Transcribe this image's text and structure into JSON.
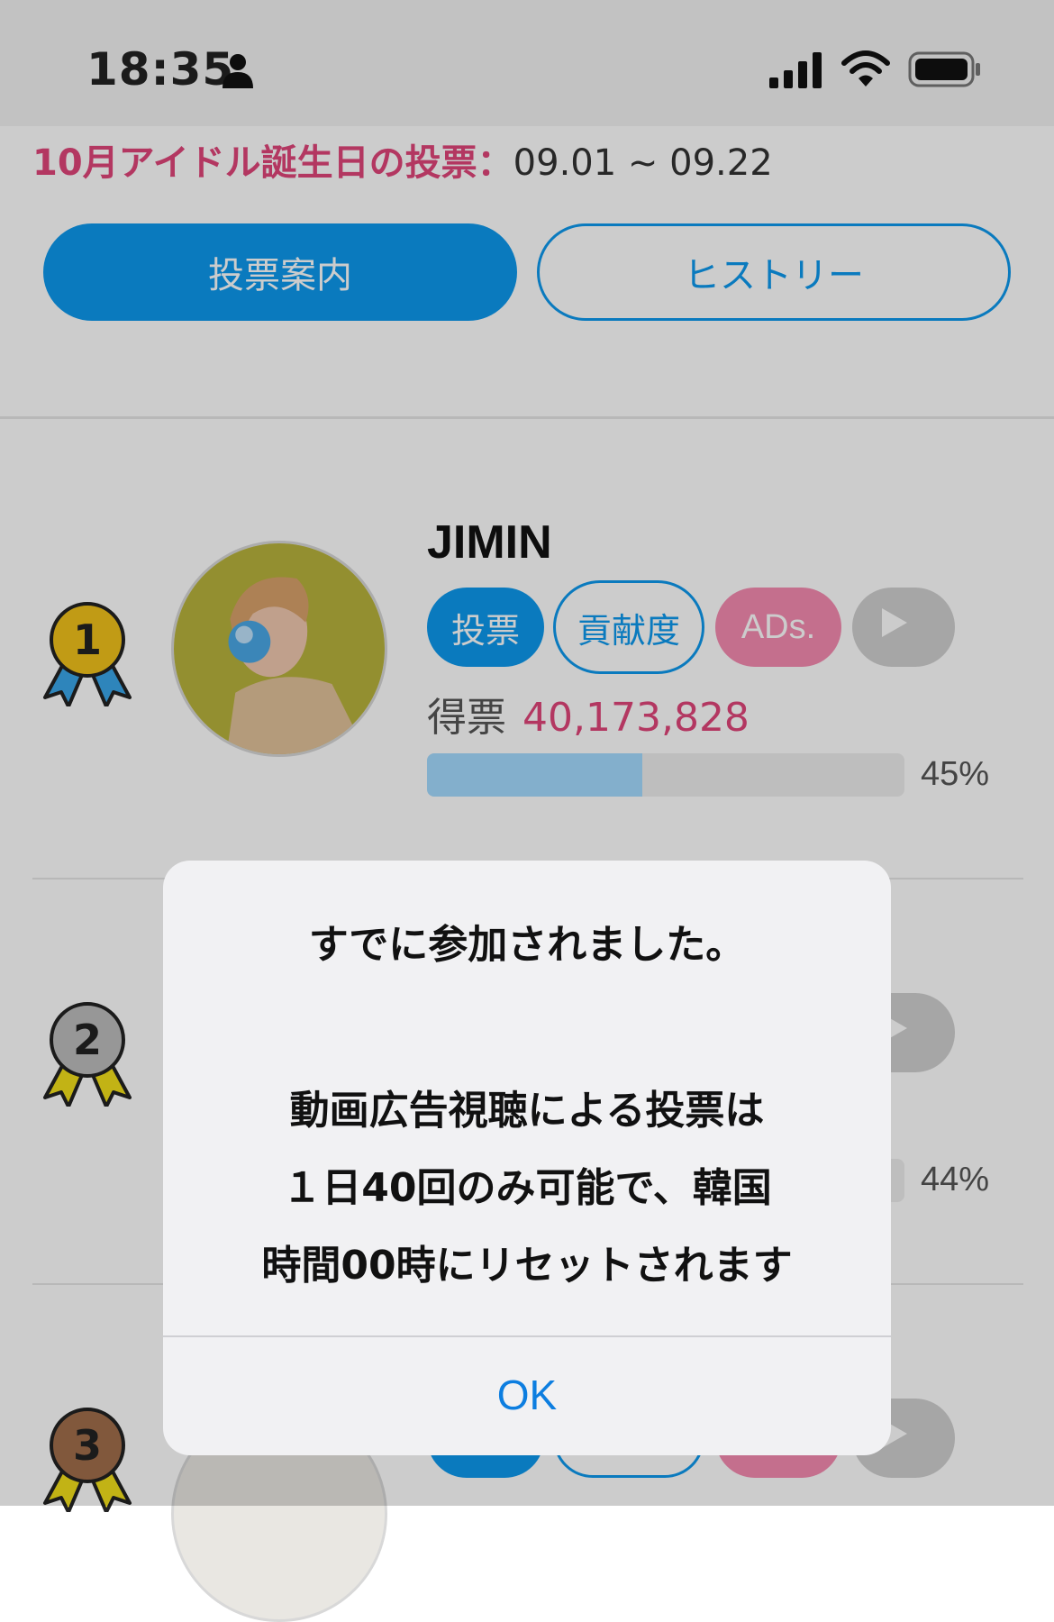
{
  "status_bar": {
    "time": "18:35"
  },
  "header": {
    "period_label": "10月アイドル誕生日の投票：",
    "period_range": "09.01 ~ 09.22"
  },
  "tabs": {
    "guide": "投票案内",
    "history": "ヒストリー"
  },
  "ranking": [
    {
      "rank": "1",
      "name": "JIMIN",
      "vote_label": "投票",
      "contribution_label": "貢献度",
      "ads_label": "ADs.",
      "votes_label": "得票",
      "votes": "40,173,828",
      "percent_text": "45%",
      "percent_value": 45,
      "medal_color": "#f2c21b",
      "ribbon_color": "#3aa7ea"
    },
    {
      "rank": "2",
      "percent_text": "44%",
      "percent_value": 44,
      "medal_color": "#bdbdbd",
      "ribbon_color": "#f3e01b"
    },
    {
      "rank": "3",
      "medal_color": "#a26e4c",
      "ribbon_color": "#f3e01b"
    }
  ],
  "dialog": {
    "title": "すでに参加されました。",
    "message_lines": [
      "動画広告視聴による投票は",
      "１日40回のみ可能で、韓国",
      "時間00時にリセットされます"
    ],
    "ok_label": "OK"
  },
  "colors": {
    "accent_blue": "#0d99ee",
    "accent_pink": "#e0457a",
    "ads_pink": "#f58bb1",
    "bar_fill": "#a4dbff"
  },
  "icons": [
    "person-icon",
    "signal-icon",
    "wifi-icon",
    "battery-icon",
    "play-icon",
    "medal-icon"
  ]
}
